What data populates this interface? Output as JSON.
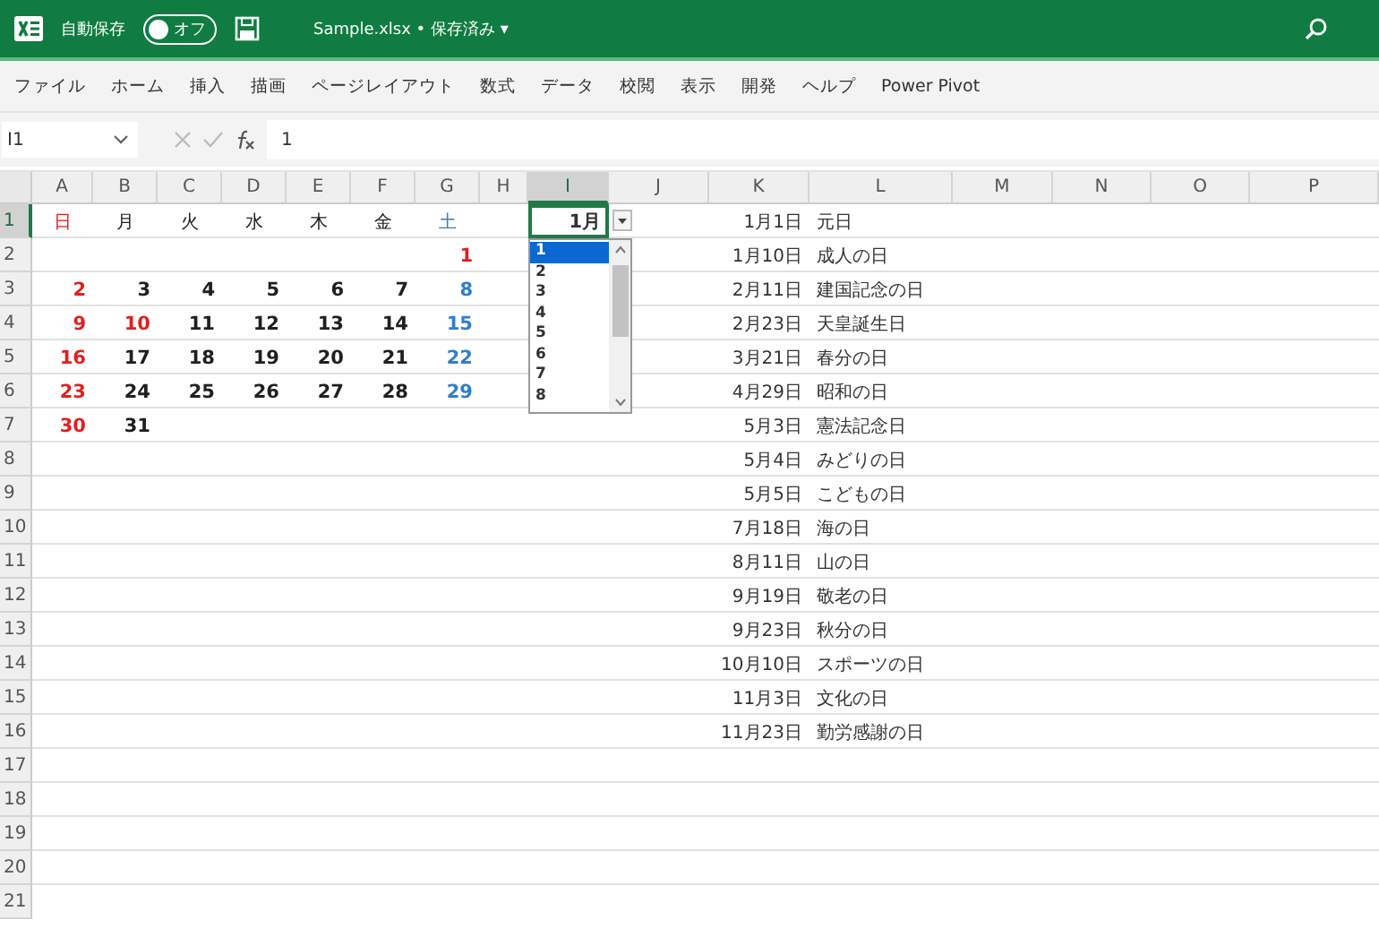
{
  "title_bar": {
    "autosave_label": "自動保存",
    "autosave_toggle": {
      "on": false,
      "label": "オフ"
    },
    "file_title": "Sample.xlsx • 保存済み",
    "caret": "▾"
  },
  "ribbon_tabs": [
    "ファイル",
    "ホーム",
    "挿入",
    "描画",
    "ページレイアウト",
    "数式",
    "データ",
    "校閲",
    "表示",
    "開発",
    "ヘルプ",
    "Power Pivot"
  ],
  "formula_bar": {
    "name_box": "I1",
    "formula": "1"
  },
  "column_headers": [
    {
      "label": "A",
      "selected": false
    },
    {
      "label": "B",
      "selected": false
    },
    {
      "label": "C",
      "selected": false
    },
    {
      "label": "D",
      "selected": false
    },
    {
      "label": "E",
      "selected": false
    },
    {
      "label": "F",
      "selected": false
    },
    {
      "label": "G",
      "selected": false
    },
    {
      "label": "H",
      "selected": false
    },
    {
      "label": "I",
      "selected": true
    },
    {
      "label": "J",
      "selected": false
    },
    {
      "label": "K",
      "selected": false
    },
    {
      "label": "L",
      "selected": false
    },
    {
      "label": "M",
      "selected": false
    },
    {
      "label": "N",
      "selected": false
    },
    {
      "label": "O",
      "selected": false
    },
    {
      "label": "P",
      "selected": false
    }
  ],
  "row_headers": [
    {
      "label": "1",
      "selected": true
    },
    {
      "label": "2",
      "selected": false
    },
    {
      "label": "3",
      "selected": false
    },
    {
      "label": "4",
      "selected": false
    },
    {
      "label": "5",
      "selected": false
    },
    {
      "label": "6",
      "selected": false
    },
    {
      "label": "7",
      "selected": false
    },
    {
      "label": "8",
      "selected": false
    },
    {
      "label": "9",
      "selected": false
    },
    {
      "label": "10",
      "selected": false
    },
    {
      "label": "11",
      "selected": false
    },
    {
      "label": "12",
      "selected": false
    },
    {
      "label": "13",
      "selected": false
    },
    {
      "label": "14",
      "selected": false
    },
    {
      "label": "15",
      "selected": false
    },
    {
      "label": "16",
      "selected": false
    },
    {
      "label": "17",
      "selected": false
    },
    {
      "label": "18",
      "selected": false
    },
    {
      "label": "19",
      "selected": false
    },
    {
      "label": "20",
      "selected": false
    },
    {
      "label": "21",
      "selected": false
    }
  ],
  "calendar": {
    "weekdays": [
      {
        "text": "日",
        "color": "#e02020"
      },
      {
        "text": "月",
        "color": "#202020"
      },
      {
        "text": "火",
        "color": "#202020"
      },
      {
        "text": "水",
        "color": "#202020"
      },
      {
        "text": "木",
        "color": "#202020"
      },
      {
        "text": "金",
        "color": "#202020"
      },
      {
        "text": "土",
        "color": "#2f7fc8"
      }
    ],
    "weeks": [
      [
        {
          "kind": "blank"
        },
        {
          "kind": "blank"
        },
        {
          "kind": "blank"
        },
        {
          "kind": "blank"
        },
        {
          "kind": "blank"
        },
        {
          "kind": "blank"
        },
        {
          "kind": "day",
          "text": "1",
          "color": "#e02020"
        }
      ],
      [
        {
          "kind": "day",
          "text": "2",
          "color": "#e02020"
        },
        {
          "kind": "day",
          "text": "3",
          "color": "#202020"
        },
        {
          "kind": "day",
          "text": "4",
          "color": "#202020"
        },
        {
          "kind": "day",
          "text": "5",
          "color": "#202020"
        },
        {
          "kind": "day",
          "text": "6",
          "color": "#202020"
        },
        {
          "kind": "day",
          "text": "7",
          "color": "#202020"
        },
        {
          "kind": "day",
          "text": "8",
          "color": "#2f7fc8"
        }
      ],
      [
        {
          "kind": "day",
          "text": "9",
          "color": "#e02020"
        },
        {
          "kind": "day",
          "text": "10",
          "color": "#e02020"
        },
        {
          "kind": "day",
          "text": "11",
          "color": "#202020"
        },
        {
          "kind": "day",
          "text": "12",
          "color": "#202020"
        },
        {
          "kind": "day",
          "text": "13",
          "color": "#202020"
        },
        {
          "kind": "day",
          "text": "14",
          "color": "#202020"
        },
        {
          "kind": "day",
          "text": "15",
          "color": "#2f7fc8"
        }
      ],
      [
        {
          "kind": "day",
          "text": "16",
          "color": "#e02020"
        },
        {
          "kind": "day",
          "text": "17",
          "color": "#202020"
        },
        {
          "kind": "day",
          "text": "18",
          "color": "#202020"
        },
        {
          "kind": "day",
          "text": "19",
          "color": "#202020"
        },
        {
          "kind": "day",
          "text": "20",
          "color": "#202020"
        },
        {
          "kind": "day",
          "text": "21",
          "color": "#202020"
        },
        {
          "kind": "day",
          "text": "22",
          "color": "#2f7fc8"
        }
      ],
      [
        {
          "kind": "day",
          "text": "23",
          "color": "#e02020"
        },
        {
          "kind": "day",
          "text": "24",
          "color": "#202020"
        },
        {
          "kind": "day",
          "text": "25",
          "color": "#202020"
        },
        {
          "kind": "day",
          "text": "26",
          "color": "#202020"
        },
        {
          "kind": "day",
          "text": "27",
          "color": "#202020"
        },
        {
          "kind": "day",
          "text": "28",
          "color": "#202020"
        },
        {
          "kind": "day",
          "text": "29",
          "color": "#2f7fc8"
        }
      ],
      [
        {
          "kind": "day",
          "text": "30",
          "color": "#e02020"
        },
        {
          "kind": "day",
          "text": "31",
          "color": "#202020"
        },
        {
          "kind": "blank"
        },
        {
          "kind": "blank"
        },
        {
          "kind": "blank"
        },
        {
          "kind": "blank"
        },
        {
          "kind": "blank"
        }
      ]
    ]
  },
  "month_cell": {
    "value": "1月"
  },
  "dropdown": {
    "items": [
      {
        "label": "1",
        "selected": true
      },
      {
        "label": "2",
        "selected": false
      },
      {
        "label": "3",
        "selected": false
      },
      {
        "label": "4",
        "selected": false
      },
      {
        "label": "5",
        "selected": false
      },
      {
        "label": "6",
        "selected": false
      },
      {
        "label": "7",
        "selected": false
      },
      {
        "label": "8",
        "selected": false
      }
    ]
  },
  "holidays": [
    {
      "date": "1月1日",
      "name": "元日"
    },
    {
      "date": "1月10日",
      "name": "成人の日"
    },
    {
      "date": "2月11日",
      "name": "建国記念の日"
    },
    {
      "date": "2月23日",
      "name": "天皇誕生日"
    },
    {
      "date": "3月21日",
      "name": "春分の日"
    },
    {
      "date": "4月29日",
      "name": "昭和の日"
    },
    {
      "date": "5月3日",
      "name": "憲法記念日"
    },
    {
      "date": "5月4日",
      "name": "みどりの日"
    },
    {
      "date": "5月5日",
      "name": "こどもの日"
    },
    {
      "date": "7月18日",
      "name": "海の日"
    },
    {
      "date": "8月11日",
      "name": "山の日"
    },
    {
      "date": "9月19日",
      "name": "敬老の日"
    },
    {
      "date": "9月23日",
      "name": "秋分の日"
    },
    {
      "date": "10月10日",
      "name": "スポーツの日"
    },
    {
      "date": "11月3日",
      "name": "文化の日"
    },
    {
      "date": "11月23日",
      "name": "勤労感謝の日"
    }
  ]
}
